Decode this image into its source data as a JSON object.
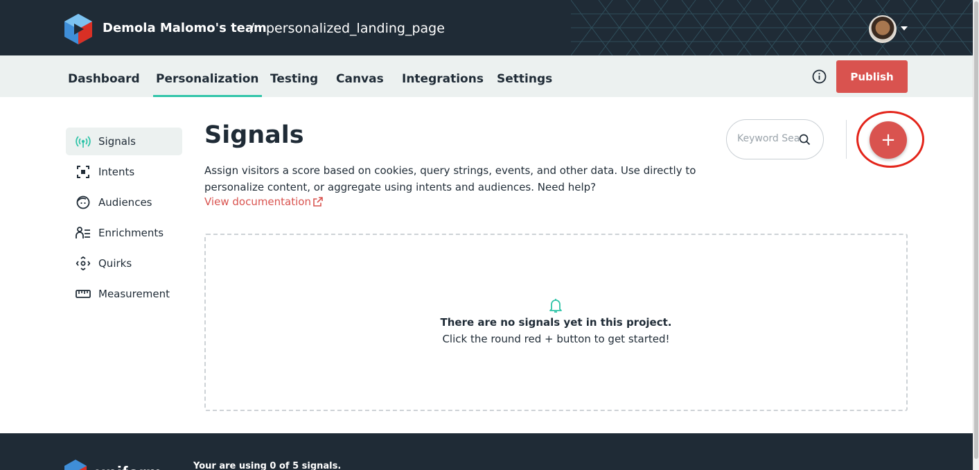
{
  "header": {
    "team_name": "Demola Malomo's team",
    "separator": "/",
    "project_name": "personalized_landing_page"
  },
  "nav": {
    "tabs": [
      {
        "label": "Dashboard"
      },
      {
        "label": "Personalization",
        "active": true
      },
      {
        "label": "Testing"
      },
      {
        "label": "Canvas"
      },
      {
        "label": "Integrations"
      },
      {
        "label": "Settings"
      }
    ],
    "publish_label": "Publish"
  },
  "sidebar": {
    "items": [
      {
        "label": "Signals",
        "icon": "broadcast-icon",
        "active": true
      },
      {
        "label": "Intents",
        "icon": "focus-target-icon"
      },
      {
        "label": "Audiences",
        "icon": "face-icon"
      },
      {
        "label": "Enrichments",
        "icon": "user-list-icon"
      },
      {
        "label": "Quirks",
        "icon": "move-arrows-icon"
      },
      {
        "label": "Measurement",
        "icon": "ruler-icon"
      }
    ]
  },
  "main": {
    "title": "Signals",
    "description": "Assign visitors a score based on cookies, query strings, events, and other data. Use directly to personalize content, or aggregate using intents and audiences. Need help?",
    "doc_link": "View documentation",
    "search_placeholder": "Keyword Search",
    "add_label": "+",
    "empty_title": "There are no signals yet in this project.",
    "empty_subtitle": "Click the round red + button to get started!"
  },
  "footer": {
    "usage": "Your are using 0 of 5 signals."
  },
  "colors": {
    "brand_dark": "#1f2b36",
    "accent_red": "#d9534f",
    "accent_teal": "#2fc4a8",
    "nav_bg": "#ecf1f0",
    "annotation_red": "#e3241a"
  }
}
